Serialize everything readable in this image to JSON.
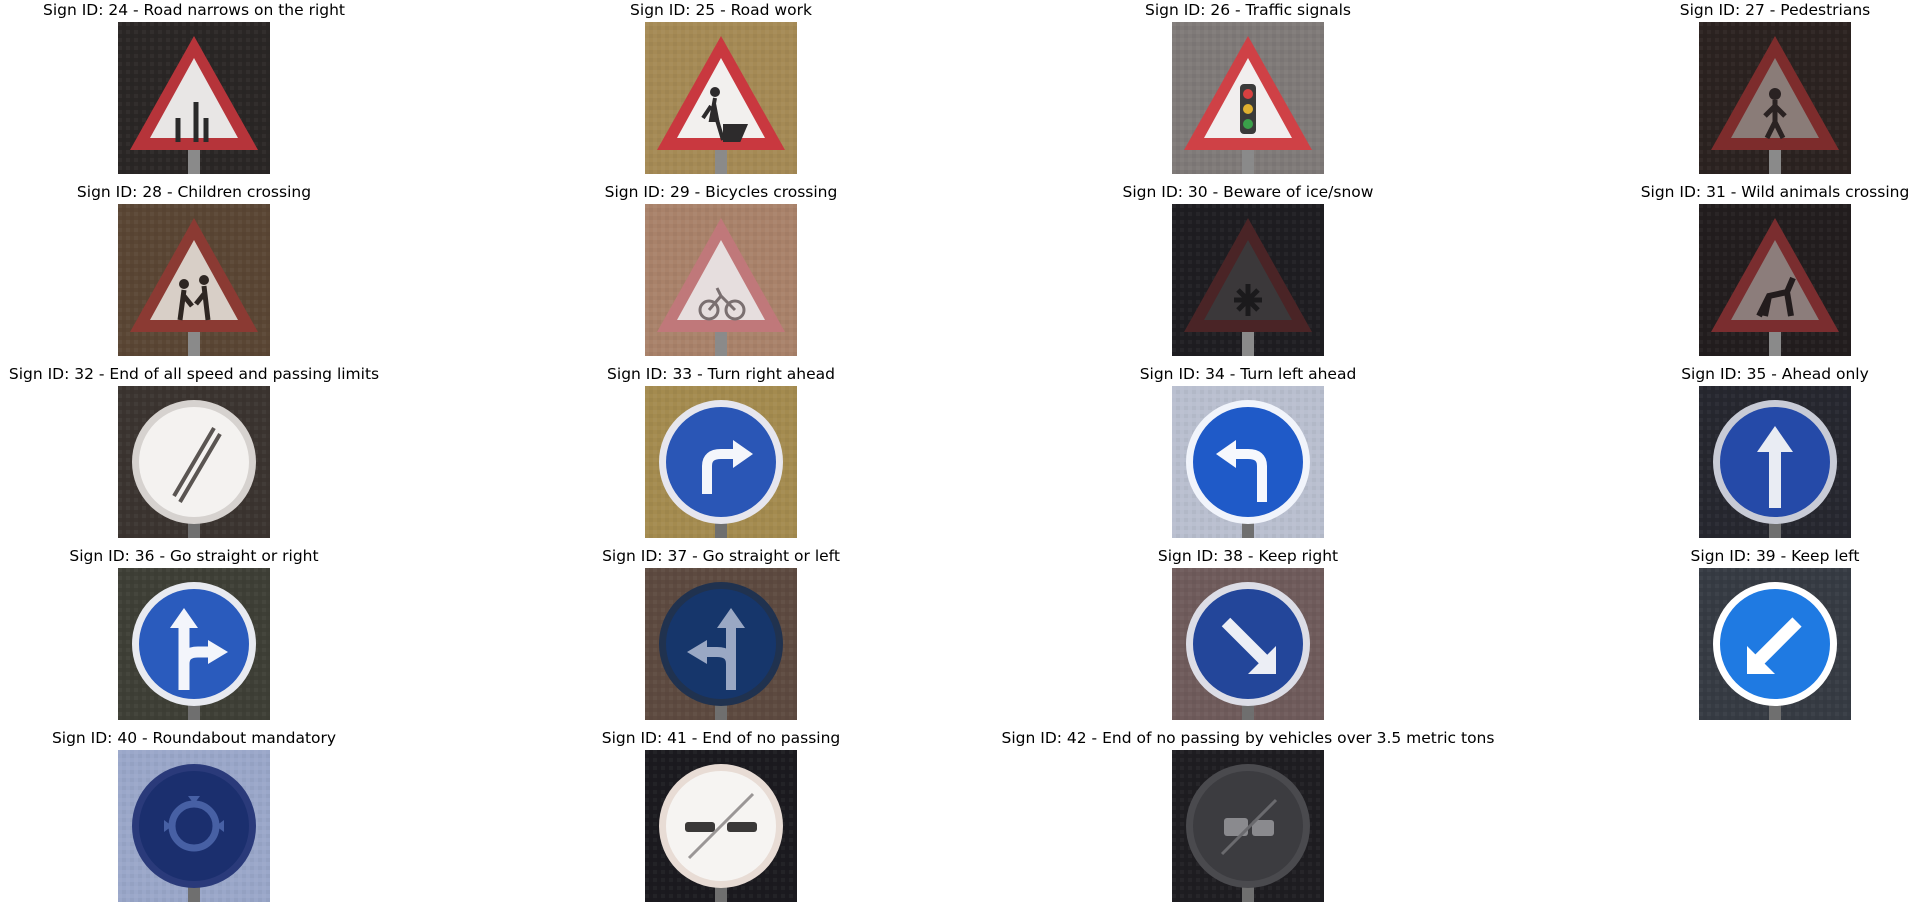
{
  "figure": {
    "signs": [
      {
        "title": "Sign ID: 24 - Road narrows on the right",
        "icon": "road-narrows-right-sign",
        "bg": "#2a2625",
        "frame": "triangle",
        "rim": "#b6343a",
        "fill": "#e8e6e5",
        "glyph": "narrow",
        "glyph_color": "#2a2a2a"
      },
      {
        "title": "Sign ID: 25 - Road work",
        "icon": "road-work-sign",
        "bg": "#a58a55",
        "frame": "triangle",
        "rim": "#c9383f",
        "fill": "#f2f0ee",
        "glyph": "worker",
        "glyph_color": "#2d2b2c"
      },
      {
        "title": "Sign ID: 26 - Traffic signals",
        "icon": "traffic-signals-sign",
        "bg": "#7f7a78",
        "frame": "triangle",
        "rim": "#cf4146",
        "fill": "#f1eeee",
        "glyph": "lights",
        "glyph_color": "#3a3a3a"
      },
      {
        "title": "Sign ID: 27 - Pedestrians",
        "icon": "pedestrians-sign",
        "bg": "#2b2220",
        "frame": "triangle",
        "rim": "#7d2c2c",
        "fill": "#8a7c78",
        "glyph": "person",
        "glyph_color": "#2a2222"
      },
      {
        "title": "Sign ID: 28 - Children crossing",
        "icon": "children-crossing-sign",
        "bg": "#5a4634",
        "frame": "triangle",
        "rim": "#8b3a33",
        "fill": "#d8cfc7",
        "glyph": "children",
        "glyph_color": "#2e2622"
      },
      {
        "title": "Sign ID: 29 - Bicycles crossing",
        "icon": "bicycles-crossing-sign",
        "bg": "#a9826a",
        "frame": "triangle",
        "rim": "#c0787a",
        "fill": "#e6dede",
        "glyph": "bicycle",
        "glyph_color": "#7a6f70"
      },
      {
        "title": "Sign ID: 30 - Beware of ice/snow",
        "icon": "ice-snow-sign",
        "bg": "#1e1d21",
        "frame": "triangle",
        "rim": "#4a2426",
        "fill": "#3b383a",
        "glyph": "snow",
        "glyph_color": "#1b1a1c"
      },
      {
        "title": "Sign ID: 31 - Wild animals crossing",
        "icon": "wild-animals-sign",
        "bg": "#221d1e",
        "frame": "triangle",
        "rim": "#7a2d2f",
        "fill": "#8c7d7b",
        "glyph": "deer",
        "glyph_color": "#231c1d"
      },
      {
        "title": "Sign ID: 32 - End of all speed and passing limits",
        "icon": "end-all-limits-sign",
        "bg": "#3b3430",
        "frame": "circle",
        "rim": "#d6d2cf",
        "fill": "#f4f2f0",
        "glyph": "slash",
        "glyph_color": "#5a5552"
      },
      {
        "title": "Sign ID: 33 - Turn right ahead",
        "icon": "turn-right-ahead-sign",
        "bg": "#a48b4f",
        "frame": "circle",
        "rim": "#e6e6ee",
        "fill": "#2a56b6",
        "glyph": "turn-right",
        "glyph_color": "#f4f6fb"
      },
      {
        "title": "Sign ID: 34 - Turn left ahead",
        "icon": "turn-left-ahead-sign",
        "bg": "#b9bfcf",
        "frame": "circle",
        "rim": "#f1f4fb",
        "fill": "#1f5ac8",
        "glyph": "turn-left",
        "glyph_color": "#f6f8fd"
      },
      {
        "title": "Sign ID: 35 - Ahead only",
        "icon": "ahead-only-sign",
        "bg": "#26272f",
        "frame": "circle",
        "rim": "#c8cbd6",
        "fill": "#254aa8",
        "glyph": "up",
        "glyph_color": "#e9ecf3"
      },
      {
        "title": "Sign ID: 36 - Go straight or right",
        "icon": "straight-or-right-sign",
        "bg": "#3e3f36",
        "frame": "circle",
        "rim": "#e8eaf0",
        "fill": "#2a5bbd",
        "glyph": "straight-right",
        "glyph_color": "#f3f5fb"
      },
      {
        "title": "Sign ID: 37 - Go straight or left",
        "icon": "straight-or-left-sign",
        "bg": "#5d4a40",
        "frame": "circle",
        "rim": "#20324f",
        "fill": "#16366b",
        "glyph": "straight-left",
        "glyph_color": "#9aa8c4"
      },
      {
        "title": "Sign ID: 38 - Keep right",
        "icon": "keep-right-sign",
        "bg": "#6f5b5b",
        "frame": "circle",
        "rim": "#dcdde6",
        "fill": "#23469a",
        "glyph": "keep-right",
        "glyph_color": "#eceef5"
      },
      {
        "title": "Sign ID: 39 - Keep left",
        "icon": "keep-left-sign",
        "bg": "#363b43",
        "frame": "circle",
        "rim": "#ffffff",
        "fill": "#1f7ae2",
        "glyph": "keep-left",
        "glyph_color": "#ffffff"
      },
      {
        "title": "Sign ID: 40 - Roundabout mandatory",
        "icon": "roundabout-sign",
        "bg": "#9aa7c9",
        "frame": "circle",
        "rim": "#2a3a7a",
        "fill": "#1b2f6e",
        "glyph": "roundabout",
        "glyph_color": "#4760a4"
      },
      {
        "title": "Sign ID: 41 - End of no passing",
        "icon": "end-no-passing-sign",
        "bg": "#1b1a1f",
        "frame": "circle",
        "rim": "#e8dcd5",
        "fill": "#f6f4f2",
        "glyph": "end-passing",
        "glyph_color": "#3a3838"
      },
      {
        "title": "Sign ID: 42 - End of no passing by vehicles over 3.5 metric tons",
        "icon": "end-no-passing-trucks-sign",
        "bg": "#1e1d21",
        "frame": "circle",
        "rim": "#4a4a4e",
        "fill": "#3c3c40",
        "glyph": "end-trucks",
        "glyph_color": "#1f1f22"
      }
    ]
  }
}
